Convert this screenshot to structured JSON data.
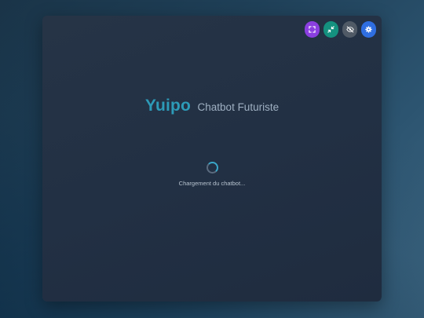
{
  "header": {
    "brand": "Yuipo",
    "subtitle": "Chatbot Futuriste"
  },
  "loading": {
    "text": "Chargement du chatbot..."
  },
  "controls": [
    {
      "name": "fullscreen",
      "icon": "expand-icon",
      "color": "#8b3fe0"
    },
    {
      "name": "minimize",
      "icon": "collapse-icon",
      "color": "#14917f"
    },
    {
      "name": "hide",
      "icon": "eye-off-icon",
      "color": "#505a66"
    },
    {
      "name": "settings",
      "icon": "gear-icon",
      "color": "#2f6ee0"
    }
  ],
  "colors": {
    "brand": "#2d9bb8",
    "panel": "#243245",
    "spinner_accent": "#3aa6c8"
  }
}
